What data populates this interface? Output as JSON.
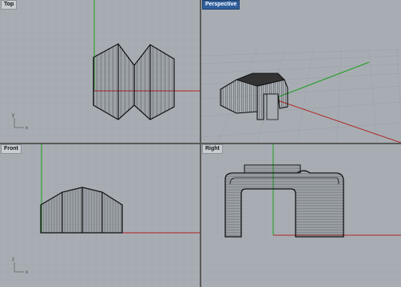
{
  "viewports": {
    "top": {
      "label": "Top"
    },
    "perspective": {
      "label": "Perspective"
    },
    "front": {
      "label": "Front"
    },
    "right": {
      "label": "Right"
    }
  },
  "active_viewport": "perspective",
  "axis_labels": {
    "x": "x",
    "y": "y",
    "z": "z"
  },
  "colors": {
    "viewport_bg": "#a7adb3",
    "grid_minor": "#9aa0a6",
    "grid_major": "#8a9096",
    "x_axis": "#b22222",
    "y_axis": "#1e9e1e",
    "active_label_bg": "#2f5f9e",
    "mesh": "#111111"
  }
}
